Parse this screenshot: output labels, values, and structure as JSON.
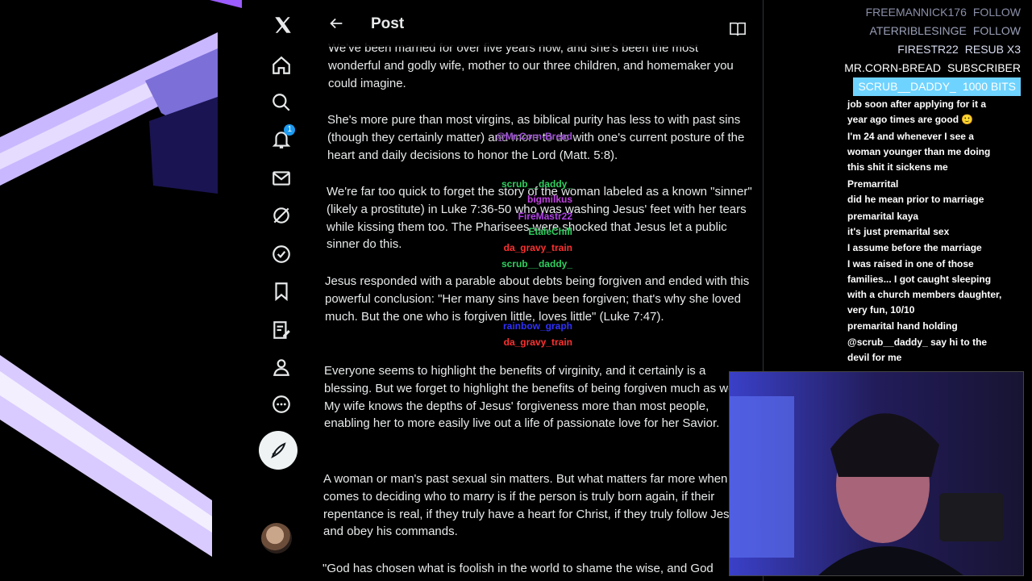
{
  "nav": {
    "notification_count": "1"
  },
  "header": {
    "title": "Post"
  },
  "post": {
    "paragraphs": [
      "We've been married for over five years now, and she's been the most wonderful and godly wife, mother to our three children, and homemaker you could imagine.",
      "She's more pure than most virgins, as biblical purity has less to with past sins (though they certainly matter) and more to do with one's current posture of the heart and daily decisions to honor the Lord (Matt. 5:8).",
      "We're far too quick to forget the story of the woman labeled as a known \"sinner\" (likely a prostitute) in Luke 7:36-50 who was washing Jesus' feet with her tears while kissing them too. The Pharisees were shocked that Jesus let a public sinner do this.",
      "Jesus responded with a parable about debts being forgiven and ended with this powerful conclusion: \"Her many sins have been forgiven; that's why she loved much. But the one who is forgiven little, loves little\" (Luke 7:47).",
      "Everyone seems to highlight the benefits of virginity, and it certainly is a blessing. But we forget to highlight the benefits of being forgiven much as well. My wife knows the depths of Jesus' forgiveness more than most people, enabling her to more easily live out a life of passionate love for her Savior.",
      "A woman or man's past sexual sin matters. But what matters far more when it comes to deciding who to marry is if the person is truly born again, if their repentance is real, if they truly have a heart for Christ, if they truly follow Jesus and obey his commands.",
      "\"God has chosen what is foolish in the world to shame the wise, and God"
    ]
  },
  "alerts": [
    {
      "user": "FREEMANNICK176",
      "action": "FOLLOW",
      "color": "#8a8fa8"
    },
    {
      "user": "ATERRIBLESINGE",
      "action": "FOLLOW",
      "color": "#9aa0b8"
    },
    {
      "user": "FIRESTR22",
      "action": "RESUB X3",
      "color": "#d8dcf0"
    },
    {
      "user": "MR.CORN-BREAD",
      "action": "SUBSCRIBER",
      "color": "#ffffff"
    },
    {
      "user": "SCRUB__DADDY_",
      "action": "1000 BITS",
      "color": "#ffffff",
      "highlight": "#6fd3ff"
    }
  ],
  "chat": [
    {
      "user": "",
      "user_color": "#fff",
      "text": "job soon after applying for it a year ago times are good 🙂"
    },
    {
      "user": "@Mr.Corn-Bread",
      "user_color": "#a050d8",
      "text": "I'm 24 and whenever I see a woman younger than me doing this shit it sickens me"
    },
    {
      "user": "scrub__daddy_",
      "user_color": "#2fcf5f",
      "text": "Premarrital"
    },
    {
      "user": "bigmilkus",
      "user_color": "#c040e0",
      "text": "did he mean prior to marriage"
    },
    {
      "user": "FireMastr22",
      "user_color": "#b040e8",
      "text": "premarital kaya"
    },
    {
      "user": "EtaleChill",
      "user_color": "#2fcf5f",
      "text": "it's just premarital sex"
    },
    {
      "user": "da_gravy_train",
      "user_color": "#ff3030",
      "text": "I assume before the marriage"
    },
    {
      "user": "scrub__daddy_",
      "user_color": "#2fcf5f",
      "text": "I was raised in one of those families... I got caught sleeping with a church members daughter, very fun, 10/10"
    },
    {
      "user": "rainbow_graph",
      "user_color": "#3030ff",
      "text": "premarital hand holding"
    },
    {
      "user": "da_gravy_train",
      "user_color": "#ff3030",
      "text": "@scrub__daddy_ say hi to the devil for me"
    }
  ]
}
